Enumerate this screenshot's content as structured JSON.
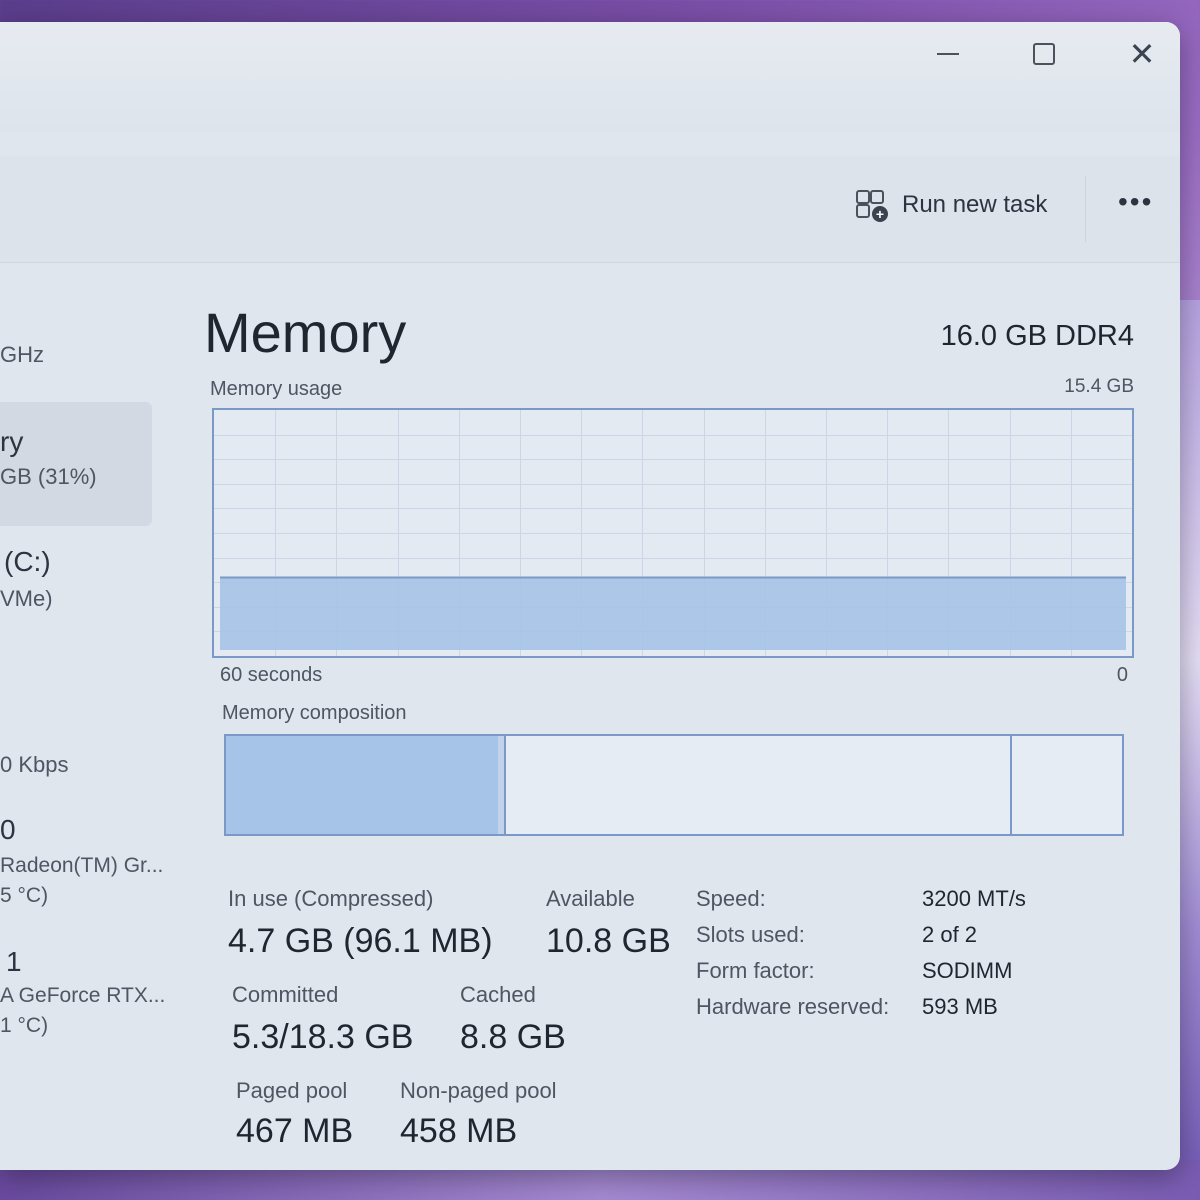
{
  "window": {
    "minimize_glyph": "",
    "close_glyph": "✕"
  },
  "toolbar": {
    "run_new_task": "Run new task",
    "more_glyph": "•••"
  },
  "sidebar": {
    "cpu_speed_partial": "GHz",
    "memory_label_partial": "ry",
    "memory_value_partial": "GB (31%)",
    "disk_label_partial": "(C:)",
    "disk_type_partial": "VMe)",
    "ethernet_partial": "0 Kbps",
    "gpu0_label_partial": "0",
    "gpu0_name_partial": "Radeon(TM) Gr...",
    "gpu0_temp_partial": "5 °C)",
    "gpu1_label_partial": "1",
    "gpu1_name_partial": "A GeForce RTX...",
    "gpu1_temp_partial": "1 °C)"
  },
  "memory": {
    "title": "Memory",
    "spec": "16.0 GB DDR4",
    "usage_label": "Memory usage",
    "usage_max": "15.4 GB",
    "time_label": "60 seconds",
    "time_end": "0",
    "composition_label": "Memory composition",
    "stats": {
      "in_use_label": "In use (Compressed)",
      "in_use_value": "4.7 GB (96.1 MB)",
      "available_label": "Available",
      "available_value": "10.8 GB",
      "committed_label": "Committed",
      "committed_value": "5.3/18.3 GB",
      "cached_label": "Cached",
      "cached_value": "8.8 GB",
      "paged_label": "Paged pool",
      "paged_value": "467 MB",
      "nonpaged_label": "Non-paged pool",
      "nonpaged_value": "458 MB"
    },
    "details": {
      "speed_label": "Speed:",
      "speed_value": "3200 MT/s",
      "slots_label": "Slots used:",
      "slots_value": "2 of 2",
      "form_label": "Form factor:",
      "form_value": "SODIMM",
      "reserved_label": "Hardware reserved:",
      "reserved_value": "593 MB"
    },
    "usage_history_fraction": [
      0.31,
      0.31,
      0.31,
      0.31,
      0.31,
      0.31,
      0.31,
      0.31,
      0.31,
      0.31,
      0.31,
      0.31,
      0.31,
      0.31,
      0.31,
      0.31,
      0.31,
      0.31,
      0.31,
      0.31,
      0.31,
      0.31,
      0.31,
      0.31,
      0.31,
      0.31,
      0.31,
      0.31,
      0.31,
      0.31,
      0.31,
      0.31,
      0.31,
      0.31,
      0.31,
      0.31,
      0.31,
      0.31,
      0.31,
      0.31,
      0.31
    ],
    "colors": {
      "accent": "#7a99c6",
      "fill": "#a6c3e8"
    }
  }
}
